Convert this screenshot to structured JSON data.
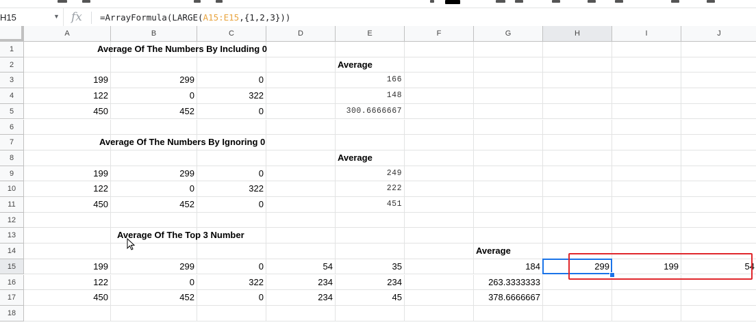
{
  "formula_bar": {
    "name_box": "H15",
    "fx_label": "fx",
    "formula_prefix": "=ArrayFormula(LARGE(",
    "formula_ref": "A15:E15",
    "formula_suffix": ",{1,2,3}))"
  },
  "columns": [
    "A",
    "B",
    "C",
    "D",
    "E",
    "F",
    "G",
    "H",
    "I",
    "J"
  ],
  "rows": [
    "1",
    "2",
    "3",
    "4",
    "5",
    "6",
    "7",
    "8",
    "9",
    "10",
    "11",
    "12",
    "13",
    "14",
    "15",
    "16",
    "17",
    "18"
  ],
  "selected_cell": "H15",
  "titles": {
    "t1": "Average Of The Numbers By Including 0",
    "t2": "Average Of The Numbers By Ignoring 0",
    "t3": "Average Of The Top 3 Number"
  },
  "cells": {
    "E2": "Average",
    "A3": "199",
    "B3": "299",
    "C3": "0",
    "E3": "166",
    "A4": "122",
    "B4": "0",
    "C4": "322",
    "E4": "148",
    "A5": "450",
    "B5": "452",
    "C5": "0",
    "E5": "300.6666667",
    "E8": "Average",
    "A9": "199",
    "B9": "299",
    "C9": "0",
    "E9": "249",
    "A10": "122",
    "B10": "0",
    "C10": "322",
    "E10": "222",
    "A11": "450",
    "B11": "452",
    "C11": "0",
    "E11": "451",
    "G14": "Average",
    "A15": "199",
    "B15": "299",
    "C15": "0",
    "D15": "54",
    "E15": "35",
    "G15": "184",
    "H15": "299",
    "I15": "199",
    "J15": "54",
    "A16": "122",
    "B16": "0",
    "C16": "322",
    "D16": "234",
    "E16": "234",
    "G16": "263.3333333",
    "A17": "450",
    "B17": "452",
    "C17": "0",
    "D17": "234",
    "E17": "45",
    "G17": "378.6666667"
  },
  "colors": {
    "selection": "#1a73e8",
    "highlight": "#e0262b",
    "formula_ref": "#e8a33d"
  }
}
